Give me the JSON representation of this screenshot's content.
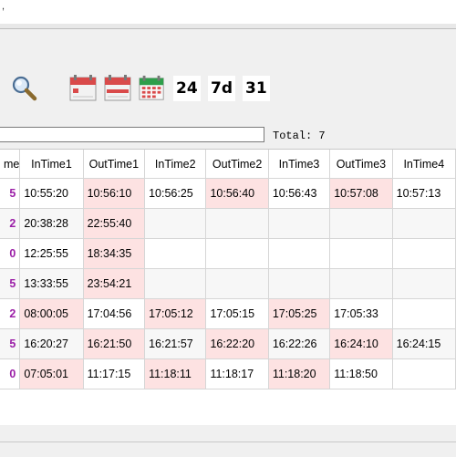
{
  "menu": {
    "glyph": ","
  },
  "toolbar": {
    "icons": [
      "search-icon",
      "calendar-month-icon",
      "calendar-day-icon",
      "calendar-grid-icon"
    ],
    "buttons": [
      "24",
      "7d",
      "31"
    ]
  },
  "filter": {
    "value": "",
    "total_text": "Total: 7"
  },
  "table": {
    "columns": [
      "me",
      "InTime1",
      "OutTime1",
      "InTime2",
      "OutTime2",
      "InTime3",
      "OutTime3",
      "InTime4"
    ],
    "rows": [
      [
        "5",
        "10:55:20",
        "10:56:10",
        "10:56:25",
        "10:56:40",
        "10:56:43",
        "10:57:08",
        "10:57:13"
      ],
      [
        "2",
        "20:38:28",
        "22:55:40",
        "",
        "",
        "",
        "",
        ""
      ],
      [
        "0",
        "12:25:55",
        "18:34:35",
        "",
        "",
        "",
        "",
        ""
      ],
      [
        "5",
        "13:33:55",
        "23:54:21",
        "",
        "",
        "",
        "",
        ""
      ],
      [
        "2",
        "08:00:05",
        "17:04:56",
        "17:05:12",
        "17:05:15",
        "17:05:25",
        "17:05:33",
        ""
      ],
      [
        "5",
        "16:20:27",
        "16:21:50",
        "16:21:57",
        "16:22:20",
        "16:22:26",
        "16:24:10",
        "16:24:15"
      ],
      [
        "0",
        "07:05:01",
        "11:17:15",
        "11:18:11",
        "11:18:17",
        "11:18:20",
        "11:18:50",
        ""
      ]
    ],
    "highlighted": [
      [
        2,
        4,
        6
      ],
      [
        2
      ],
      [
        2
      ],
      [
        2
      ],
      [
        1,
        3,
        5
      ],
      [
        2,
        4,
        6
      ],
      [
        1,
        3,
        5
      ]
    ],
    "highlight_color": "#fde2e2",
    "id_color": "#9b1fa7"
  }
}
